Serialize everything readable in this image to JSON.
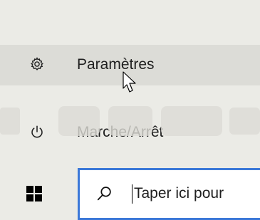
{
  "start_menu": {
    "items": [
      {
        "label": "Paramètres",
        "icon": "gear-icon",
        "state": "hover"
      },
      {
        "label": "Marche/Arrêt",
        "icon": "power-icon"
      }
    ]
  },
  "taskbar": {
    "start_icon": "windows-logo-icon",
    "search": {
      "icon": "search-icon",
      "placeholder": "Taper ici pour"
    }
  },
  "colors": {
    "panel": "#ebebe6",
    "hover": "#dcdcd7",
    "search_border": "#3b78d8",
    "text": "#1f1f1f"
  }
}
